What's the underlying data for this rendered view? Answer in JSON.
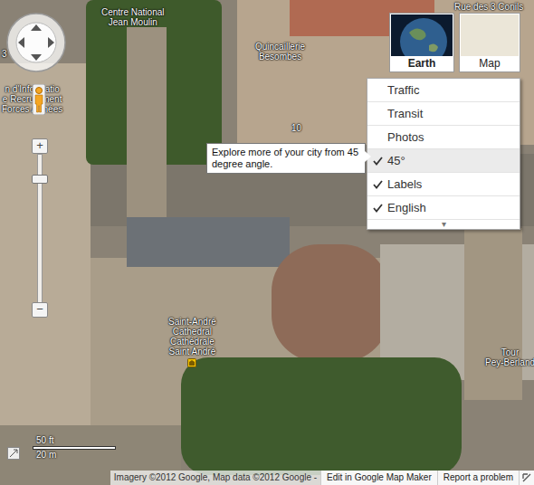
{
  "map_labels": [
    {
      "lines": [
        "Centre National",
        "Jean Moulin"
      ]
    },
    {
      "lines": [
        "Quincaillerie",
        "Besombes"
      ]
    },
    {
      "lines": [
        "Rue des 3 Conils"
      ]
    },
    {
      "lines": [
        "3"
      ]
    },
    {
      "lines": [
        "n d'Informatio",
        "e Recrutement",
        "Forces Armées"
      ]
    },
    {
      "lines": [
        "10"
      ]
    },
    {
      "lines": [
        "Saint-André",
        "Cathedral",
        "Cathédrale",
        "Saint André"
      ]
    },
    {
      "lines": [
        "Tour",
        "Pey-Berland"
      ]
    }
  ],
  "zoom": {
    "plus": "+",
    "minus": "−",
    "level": 0.85
  },
  "map_types": [
    {
      "label": "Earth",
      "selected": true
    },
    {
      "label": "Map",
      "selected": false
    }
  ],
  "layers_menu": {
    "items": [
      {
        "label": "Traffic",
        "checked": false,
        "selected": false
      },
      {
        "label": "Transit",
        "checked": false,
        "selected": false
      },
      {
        "label": "Photos",
        "checked": false,
        "selected": false
      },
      {
        "label": "45°",
        "checked": true,
        "selected": true
      },
      {
        "label": "Labels",
        "checked": true,
        "selected": false
      },
      {
        "label": "English",
        "checked": true,
        "selected": false
      }
    ],
    "more": "▾"
  },
  "tooltip": {
    "text": "Explore more of your city from 45 degree angle."
  },
  "scale": {
    "imperial": "50 ft",
    "metric": "20 m"
  },
  "footer": {
    "attribution": "Imagery ©2012 Google, Map data ©2012 Google -",
    "links": [
      "Edit in Google Map Maker",
      "Report a problem"
    ]
  }
}
